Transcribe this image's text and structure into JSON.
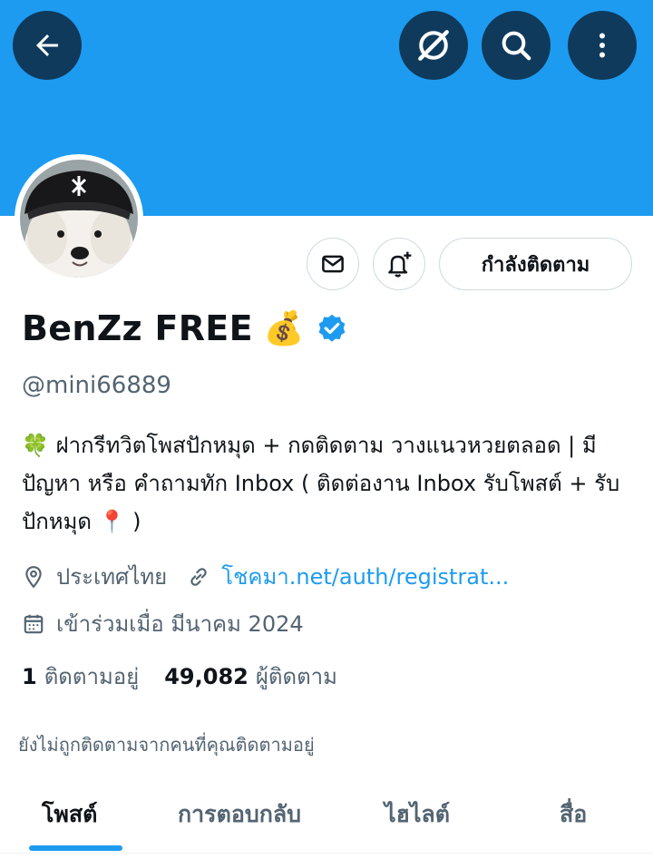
{
  "header": {
    "icons": [
      "back-arrow-icon",
      "grok-icon",
      "search-icon",
      "more-vertical-icon"
    ]
  },
  "profile": {
    "name": "BenZz FREE",
    "name_emoji": "💰",
    "handle": "@mini66889",
    "verified_color": "#1d9bf0",
    "bio": "🍀 ฝากรีทวิตโพสปักหมุด + กดติดตาม วางแนวหวยตลอด | มีปัญหา หรือ คำถามทัก Inbox ( ติดต่องาน Inbox รับโพสต์ + รับปักหมุด 📍 )",
    "location": "ประเทศไทย",
    "link": "โชคมา.net/auth/registrat...",
    "joined": "เข้าร่วมเมื่อ มีนาคม 2024",
    "following_count": "1",
    "following_label": "ติดตามอยู่",
    "followers_count": "49,082",
    "followers_label": "ผู้ติดตาม",
    "not_followed_note": "ยังไม่ถูกติดตามจากคนที่คุณติดตามอยู่"
  },
  "actions": {
    "follow_label": "กำลังติดตาม",
    "icons": [
      "mail-icon",
      "bell-plus-icon"
    ]
  },
  "tabs": [
    {
      "label": "โพสต์",
      "active": true
    },
    {
      "label": "การตอบกลับ",
      "active": false
    },
    {
      "label": "ไฮไลต์",
      "active": false
    },
    {
      "label": "สื่อ",
      "active": false
    }
  ],
  "colors": {
    "accent": "#1d9bf0",
    "banner": "#1d9bf0",
    "header_button": "#0f3a5c"
  }
}
